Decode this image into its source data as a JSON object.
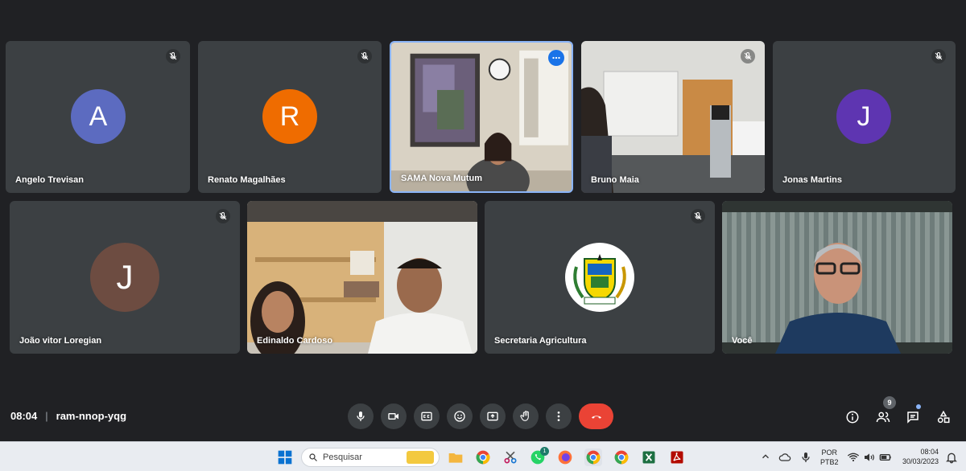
{
  "meeting": {
    "time": "08:04",
    "separator": "|",
    "code": "ram-nnop-yqg",
    "participant_count": "9"
  },
  "participants": [
    {
      "name": "Angelo Trevisan",
      "initial": "A",
      "avatar_color": "#5c6bc0",
      "muted": true
    },
    {
      "name": "Renato Magalhães",
      "initial": "R",
      "avatar_color": "#ef6c00",
      "muted": true
    },
    {
      "name": "SAMA Nova Mutum",
      "video": true,
      "active_speaker": true
    },
    {
      "name": "Bruno Maia",
      "video": true,
      "muted": true
    },
    {
      "name": "Jonas Martins",
      "initial": "J",
      "avatar_color": "#5e35b1",
      "muted": true
    },
    {
      "name": "João vitor Loregian",
      "initial": "J",
      "avatar_color": "#6d4c41",
      "muted": true
    },
    {
      "name": "Edinaldo Cardoso",
      "video": true
    },
    {
      "name": "Secretaria Agricultura",
      "logo": true,
      "muted": true
    },
    {
      "name": "Você",
      "video": true
    }
  ],
  "controls": {
    "mic": "microphone-icon",
    "camera": "camera-icon",
    "captions": "captions-icon",
    "emoji": "emoji-icon",
    "present": "present-icon",
    "raise_hand": "hand-icon",
    "more": "more-icon",
    "leave": "end-call-icon",
    "leave_color": "#ea4335"
  },
  "taskbar": {
    "search_placeholder": "Pesquisar",
    "lang_line1": "POR",
    "lang_line2": "PTB2",
    "clock_time": "08:04",
    "clock_date": "30/03/2023",
    "whatsapp_badge": "1"
  }
}
